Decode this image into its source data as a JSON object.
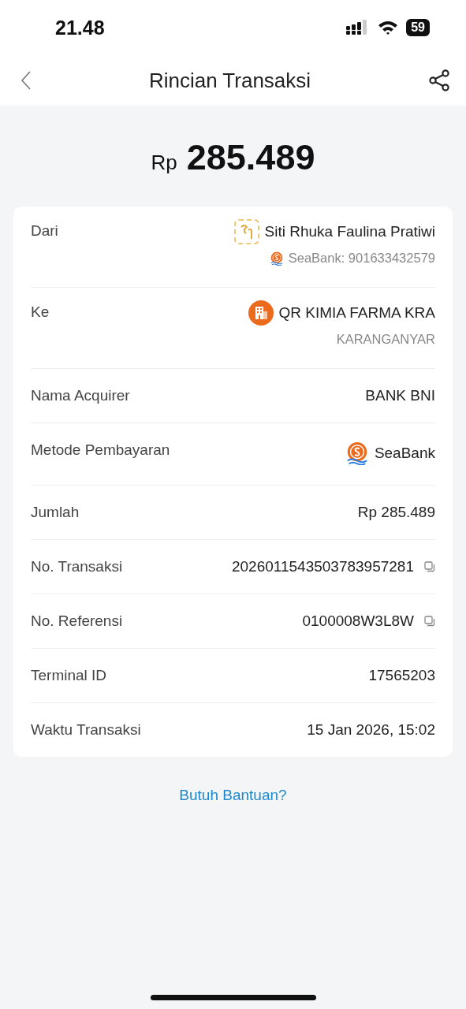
{
  "status_bar": {
    "time": "21.48",
    "battery": "59"
  },
  "header": {
    "title": "Rincian Transaksi"
  },
  "amount": {
    "currency": "Rp",
    "value": "285.489"
  },
  "rows": [
    {
      "kind": "party",
      "label": "Dari",
      "name": "Siti Rhuka Faulina Pratiwi",
      "detail": "SeaBank: 901633432579"
    },
    {
      "kind": "party",
      "label": "Ke",
      "name": "QR KIMIA FARMA KRA",
      "detail": "KARANGANYAR"
    },
    {
      "kind": "plain",
      "label": "Nama Acquirer",
      "value": "BANK BNI"
    },
    {
      "kind": "method",
      "label": "Metode Pembayaran",
      "value": "SeaBank"
    },
    {
      "kind": "plain",
      "label": "Jumlah",
      "value": "Rp 285.489"
    },
    {
      "kind": "copy",
      "label": "No. Transaksi",
      "value": "2026011543503783957281"
    },
    {
      "kind": "copy",
      "label": "No. Referensi",
      "value": "0100008W3L8W"
    },
    {
      "kind": "plain",
      "label": "Terminal ID",
      "value": "17565203"
    },
    {
      "kind": "plain",
      "label": "Waktu Transaksi",
      "value": "15 Jan 2026, 15:02"
    }
  ],
  "help_link": "Butuh Bantuan?"
}
